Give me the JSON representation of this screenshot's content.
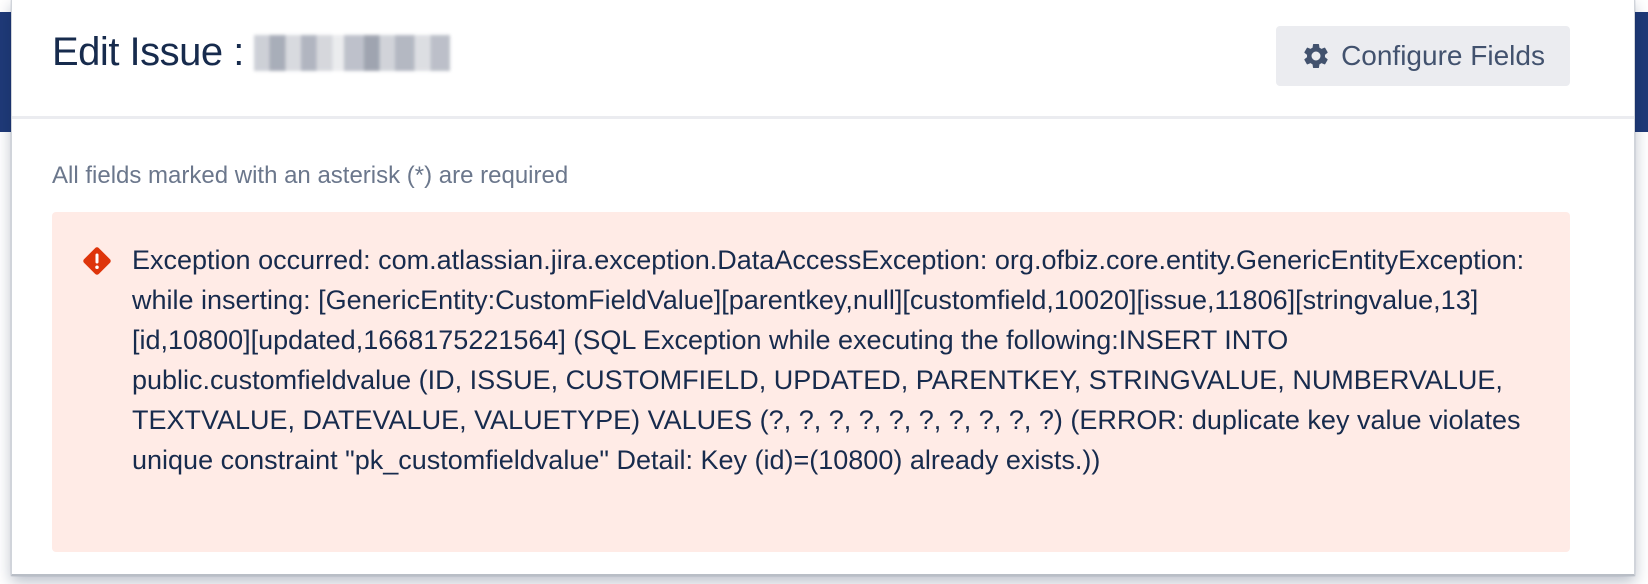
{
  "header": {
    "title": "Edit Issue :",
    "configure_label": "Configure Fields"
  },
  "form": {
    "required_note": "All fields marked with an asterisk (*) are required"
  },
  "error": {
    "message": "Exception occurred: com.atlassian.jira.exception.DataAccessException: org.ofbiz.core.entity.GenericEntityException: while inserting: [GenericEntity:CustomFieldValue][parentkey,null][customfield,10020][issue,11806][stringvalue,13][id,10800][updated,1668175221564] (SQL Exception while executing the following:INSERT INTO public.customfieldvalue (ID, ISSUE, CUSTOMFIELD, UPDATED, PARENTKEY, STRINGVALUE, NUMBERVALUE, TEXTVALUE, DATEVALUE, VALUETYPE) VALUES (?, ?, ?, ?, ?, ?, ?, ?, ?, ?) (ERROR: duplicate key value violates unique constraint \"pk_customfieldvalue\" Detail: Key (id)=(10800) already exists.))",
    "icon": "error-icon",
    "color": "#de350b"
  },
  "colors": {
    "error_bg": "#ffebe6",
    "button_bg": "#ebecf0",
    "title": "#172b4d"
  }
}
